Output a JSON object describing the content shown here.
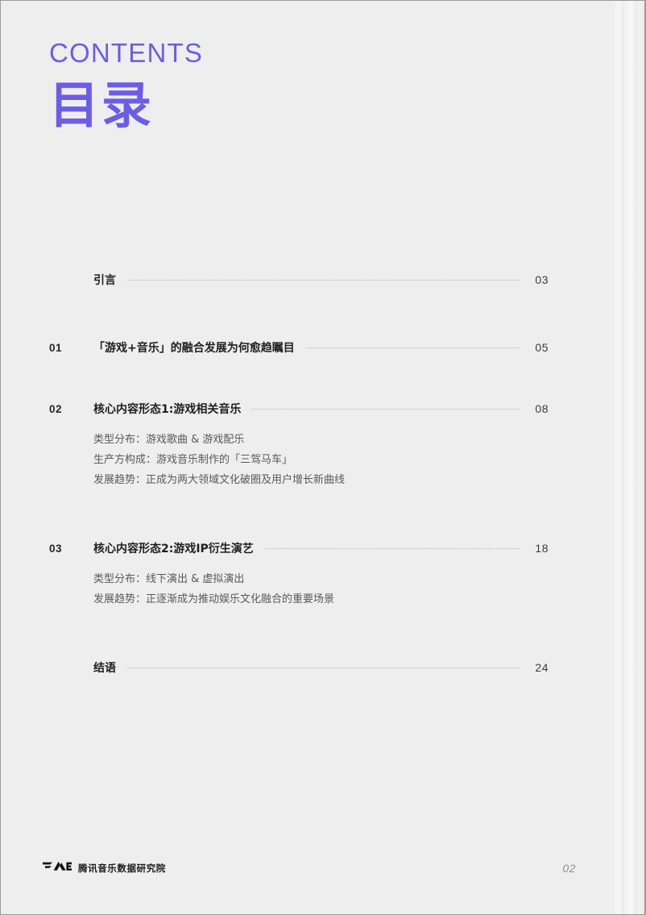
{
  "header": {
    "title_en": "CONTENTS",
    "title_cn": "目录",
    "accent_color": "#6c5ce8"
  },
  "toc": {
    "entries": [
      {
        "number": "",
        "title": "引言",
        "page": "03",
        "subs": []
      },
      {
        "number": "01",
        "title": "「游戏+音乐」的融合发展为何愈趋瞩目",
        "page": "05",
        "subs": []
      },
      {
        "number": "02",
        "title": "核心内容形态1:游戏相关音乐",
        "page": "08",
        "subs": [
          "类型分布：游戏歌曲 & 游戏配乐",
          "生产方构成：游戏音乐制作的「三驾马车」",
          "发展趋势：正成为两大领域文化破圈及用户增长新曲线"
        ]
      },
      {
        "number": "03",
        "title": "核心内容形态2:游戏IP衍生演艺",
        "page": "18",
        "subs": [
          "类型分布：线下演出 & 虚拟演出",
          "发展趋势：正逐渐成为推动娱乐文化融合的重要场景"
        ]
      },
      {
        "number": "",
        "title": "结语",
        "page": "24",
        "subs": []
      }
    ]
  },
  "footer": {
    "logo_icon": "tme-logo-icon",
    "brand_name": "腾讯音乐数据研究院",
    "page_number": "02"
  }
}
